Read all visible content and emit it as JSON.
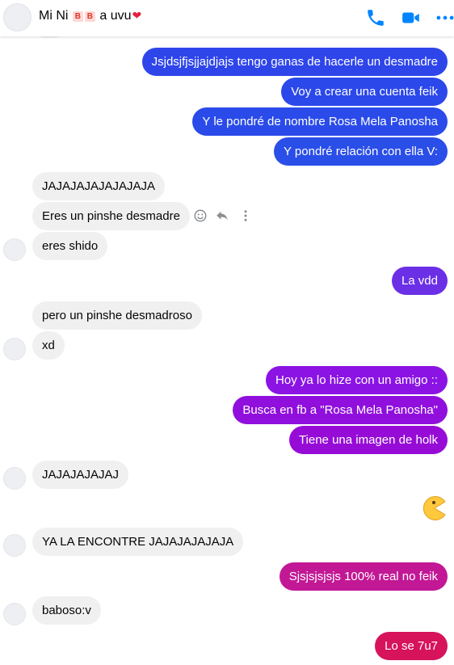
{
  "header": {
    "title_prefix": "Mi Ni",
    "badge_letter": "B",
    "title_suffix": "a uvu",
    "heart": "❤",
    "phone_icon": "phone-icon",
    "video_icon": "video-camera-icon",
    "more_icon": "more-horizontal-icon"
  },
  "colors": {
    "accent": "#0084ff",
    "blue": "#2351e8",
    "purple": "#8d12e0",
    "magenta": "#c01b95",
    "red": "#d4135a",
    "incoming": "#f0f0f0"
  },
  "messages": [
    {
      "from": "me",
      "text": "Jsjdsjfjsjjajdjajs tengo ganas de hacerle un desmadre"
    },
    {
      "from": "me",
      "text": "Voy a crear una cuenta feik"
    },
    {
      "from": "me",
      "text": "Y le pondré de nombre Rosa Mela Panosha"
    },
    {
      "from": "me",
      "text": "Y pondré relación con ella V:"
    },
    {
      "from": "them",
      "text": "JAJAJAJAJAJAJAJA"
    },
    {
      "from": "them",
      "text": "Eres un pinshe desmadre"
    },
    {
      "from": "them",
      "text": "eres shido"
    },
    {
      "from": "me",
      "text": "La vdd"
    },
    {
      "from": "them",
      "text": "pero un pinshe desmadroso"
    },
    {
      "from": "them",
      "text": "xd"
    },
    {
      "from": "me",
      "text": "Hoy ya lo hize con un amigo ::"
    },
    {
      "from": "me",
      "text": "Busca en fb a \"Rosa Mela Panosha\""
    },
    {
      "from": "me",
      "text": "Tiene una imagen de holk"
    },
    {
      "from": "them",
      "text": "JAJAJAJAJAJ"
    },
    {
      "from": "me",
      "emoji": "pacman-emoji"
    },
    {
      "from": "them",
      "text": "YA LA ENCONTRE JAJAJAJAJAJA"
    },
    {
      "from": "me",
      "text": "Sjsjsjsjsjs 100% real no feik"
    },
    {
      "from": "them",
      "text": "baboso:v"
    },
    {
      "from": "me",
      "text": "Lo se 7u7"
    }
  ],
  "hover_actions": [
    "react-icon",
    "reply-icon",
    "more-vertical-icon"
  ]
}
